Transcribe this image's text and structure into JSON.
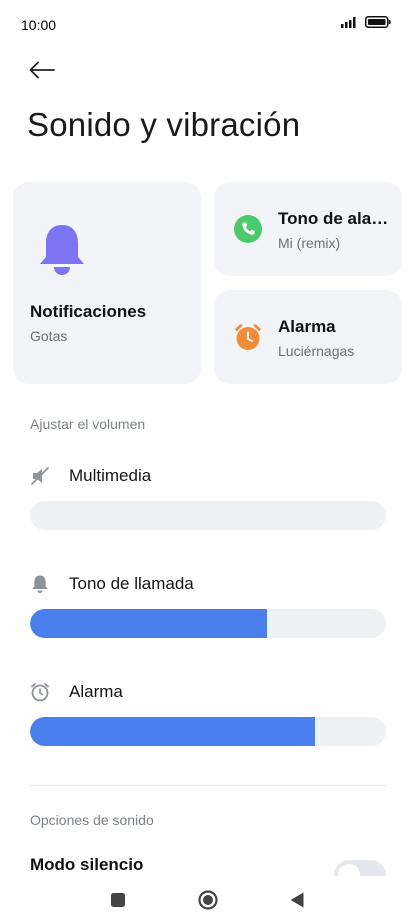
{
  "status": {
    "time": "10:00"
  },
  "header": {
    "title": "Sonido y vibración"
  },
  "cards": {
    "notifications": {
      "title": "Notificaciones",
      "subtitle": "Gotas",
      "icon": "bell-icon",
      "color": "#7c74f0"
    },
    "ringtone": {
      "title": "Tono de alarma",
      "subtitle": "Mi (remix)",
      "icon": "phone-icon",
      "color": "#4cc96a"
    },
    "alarm": {
      "title": "Alarma",
      "subtitle": "Luciérnagas",
      "icon": "alarm-clock-icon",
      "color": "#f28c3a"
    }
  },
  "volume": {
    "section_label": "Ajustar el volumen",
    "rows": [
      {
        "label": "Multimedia",
        "icon": "muted-speaker-icon",
        "level": 0.0
      },
      {
        "label": "Tono de llamada",
        "icon": "bell-icon",
        "level": 0.665
      },
      {
        "label": "Alarma",
        "icon": "alarm-clock-icon",
        "level": 0.8
      }
    ]
  },
  "sound_options": {
    "section_label": "Opciones de sonido",
    "silent_mode": {
      "label": "Modo silencio",
      "enabled": false
    }
  },
  "colors": {
    "accent": "#4a80ee",
    "card_bg": "#f2f4f7",
    "track_bg": "#eef1f4"
  }
}
